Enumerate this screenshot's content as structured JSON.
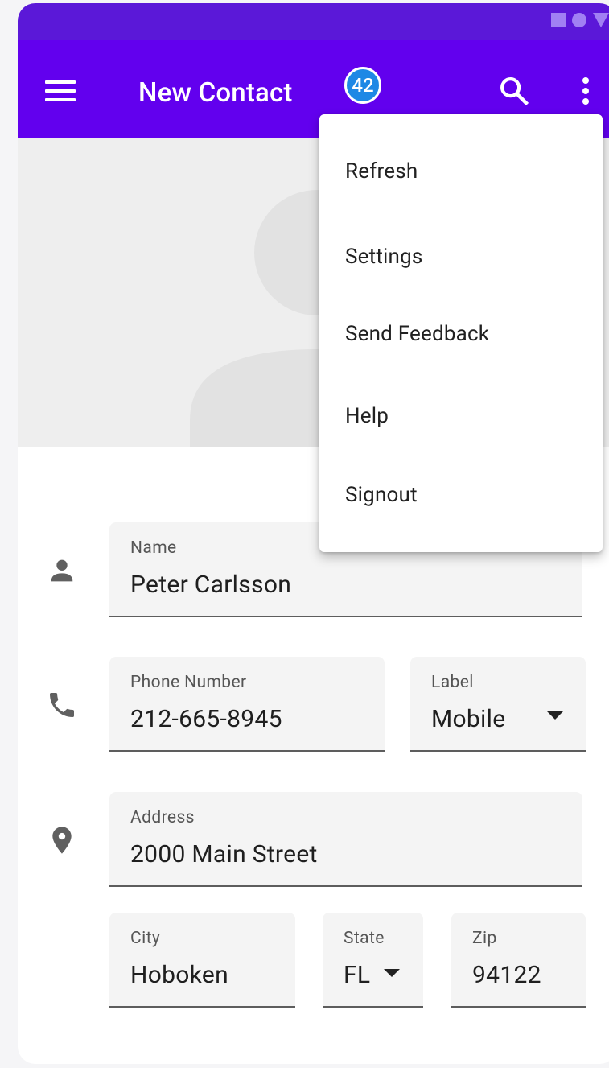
{
  "app_bar": {
    "title": "New Contact",
    "badge_count": "42",
    "color": "#6200ee",
    "status_bar_color": "#5b18d8"
  },
  "icons": {
    "menu": "hamburger-menu-icon",
    "search": "search-icon",
    "overflow": "more-vertical-icon",
    "person": "person-icon",
    "phone": "phone-icon",
    "location": "location-pin-icon"
  },
  "overflow_menu": {
    "items": [
      "Refresh",
      "Settings",
      "Send Feedback",
      "Help",
      "Signout"
    ]
  },
  "form": {
    "name": {
      "label": "Name",
      "value": "Peter Carlsson"
    },
    "phone": {
      "label": "Phone Number",
      "value": "212-665-8945"
    },
    "phone_type": {
      "label": "Label",
      "value": "Mobile"
    },
    "address": {
      "label": "Address",
      "value": "2000 Main Street"
    },
    "city": {
      "label": "City",
      "value": "Hoboken"
    },
    "state": {
      "label": "State",
      "value": "FL"
    },
    "zip": {
      "label": "Zip",
      "value": "94122"
    }
  }
}
